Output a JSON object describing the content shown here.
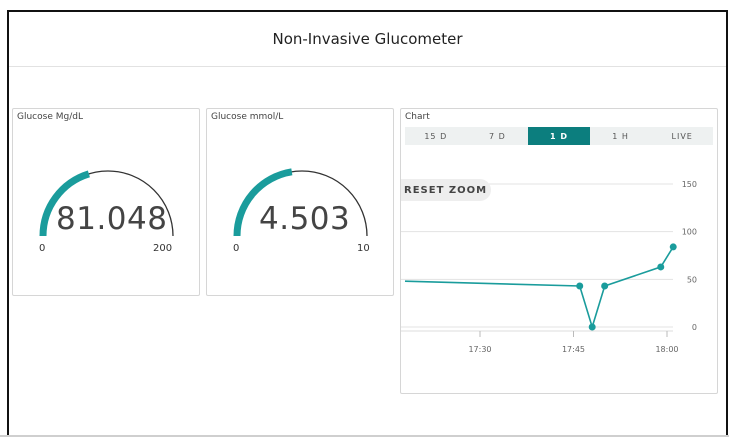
{
  "header": {
    "title": "Non-Invasive Glucometer"
  },
  "gauges": [
    {
      "title": "Glucose Mg/dL",
      "value": "81.048",
      "min": "0",
      "max": "200",
      "fraction": 0.405
    },
    {
      "title": "Glucose mmol/L",
      "value": "4.503",
      "min": "0",
      "max": "10",
      "fraction": 0.45
    }
  ],
  "chart_widget": {
    "title": "Chart",
    "tabs": [
      {
        "label": "15 D",
        "active": false
      },
      {
        "label": "7 D",
        "active": false
      },
      {
        "label": "1 D",
        "active": true
      },
      {
        "label": "1 H",
        "active": false
      },
      {
        "label": "LIVE",
        "active": false
      }
    ],
    "reset_zoom_label": "RESET ZOOM"
  },
  "colors": {
    "accent": "#1a9c9c",
    "tab_active": "#0c7e7e"
  },
  "chart_data": {
    "type": "line",
    "x": [
      "17:10",
      "17:46",
      "17:48",
      "17:50",
      "17:59",
      "18:01"
    ],
    "values": [
      48,
      43,
      0,
      43,
      63,
      84
    ],
    "xticks": [
      "17:30",
      "17:45",
      "18:00"
    ],
    "yticks": [
      "0",
      "50",
      "100",
      "150"
    ],
    "ylim": [
      0,
      150
    ],
    "grid": true,
    "yaxis_position": "right"
  }
}
